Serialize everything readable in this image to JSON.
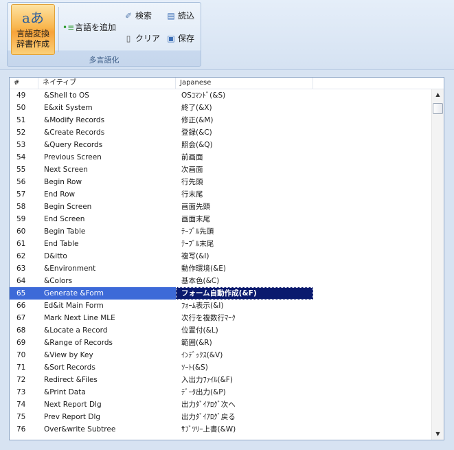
{
  "ribbon": {
    "group_label": "多言語化",
    "big_button": {
      "label_line1": "言語変換",
      "label_line2": "辞書作成",
      "icon_text": "aあ",
      "icon": "language-translate-icon"
    },
    "add_language": {
      "label": "言語を追加",
      "icon": "add-language-icon"
    },
    "search": {
      "label": "検索",
      "icon": "search-icon"
    },
    "load": {
      "label": "読込",
      "icon": "load-icon"
    },
    "clear": {
      "label": "クリア",
      "icon": "clear-document-icon"
    },
    "save": {
      "label": "保存",
      "icon": "save-icon"
    }
  },
  "table": {
    "columns": [
      "#",
      "ネイティブ",
      "Japanese"
    ],
    "selected_index": 16,
    "rows": [
      {
        "num": "49",
        "native": "&Shell to OS",
        "jp": "OSｺﾏﾝﾄﾞ(&S)"
      },
      {
        "num": "50",
        "native": "E&xit System",
        "jp": "終了(&X)"
      },
      {
        "num": "51",
        "native": "&Modify Records",
        "jp": "修正(&M)"
      },
      {
        "num": "52",
        "native": "&Create Records",
        "jp": "登録(&C)"
      },
      {
        "num": "53",
        "native": "&Query Records",
        "jp": "照会(&Q)"
      },
      {
        "num": "54",
        "native": "Previous Screen",
        "jp": "前画面"
      },
      {
        "num": "55",
        "native": "Next Screen",
        "jp": "次画面"
      },
      {
        "num": "56",
        "native": "Begin Row",
        "jp": "行先頭"
      },
      {
        "num": "57",
        "native": "End Row",
        "jp": "行末尾"
      },
      {
        "num": "58",
        "native": "Begin Screen",
        "jp": "画面先頭"
      },
      {
        "num": "59",
        "native": "End Screen",
        "jp": "画面末尾"
      },
      {
        "num": "60",
        "native": "Begin Table",
        "jp": "ﾃｰﾌﾞﾙ先頭"
      },
      {
        "num": "61",
        "native": "End Table",
        "jp": "ﾃｰﾌﾞﾙ末尾"
      },
      {
        "num": "62",
        "native": "D&itto",
        "jp": "複写(&I)"
      },
      {
        "num": "63",
        "native": "&Environment",
        "jp": "動作環境(&E)"
      },
      {
        "num": "64",
        "native": "&Colors",
        "jp": "基本色(&C)"
      },
      {
        "num": "65",
        "native": "Generate &Form",
        "jp": "フォーム自動作成(&F)"
      },
      {
        "num": "66",
        "native": "Ed&it Main Form",
        "jp": "ﾌｫｰﾑ表示(&I)"
      },
      {
        "num": "67",
        "native": "Mark Next Line MLE",
        "jp": "次行を複数行ﾏｰｸ"
      },
      {
        "num": "68",
        "native": "&Locate a Record",
        "jp": "位置付(&L)"
      },
      {
        "num": "69",
        "native": "&Range of Records",
        "jp": "範囲(&R)"
      },
      {
        "num": "70",
        "native": "&View by Key",
        "jp": "ｲﾝﾃﾞｯｸｽ(&V)"
      },
      {
        "num": "71",
        "native": "&Sort Records",
        "jp": "ｿｰﾄ(&S)"
      },
      {
        "num": "72",
        "native": "Redirect &Files",
        "jp": "入出力ﾌｧｲﾙ(&F)"
      },
      {
        "num": "73",
        "native": "&Print Data",
        "jp": "ﾃﾞｰﾀ出力(&P)"
      },
      {
        "num": "74",
        "native": "Next Report Dlg",
        "jp": "出力ﾀﾞｲｱﾛｸﾞ次へ"
      },
      {
        "num": "75",
        "native": "Prev Report Dlg",
        "jp": "出力ﾀﾞｲｱﾛｸﾞ戻る"
      },
      {
        "num": "76",
        "native": "Over&write Subtree",
        "jp": "ｻﾌﾞﾂﾘｰ上書(&W)"
      }
    ]
  },
  "colors": {
    "selection": "#3d6ad8",
    "selection_focus": "#0a1a6e",
    "ribbon_bg": "#dde8f5",
    "big_button": "#f9b74f"
  }
}
